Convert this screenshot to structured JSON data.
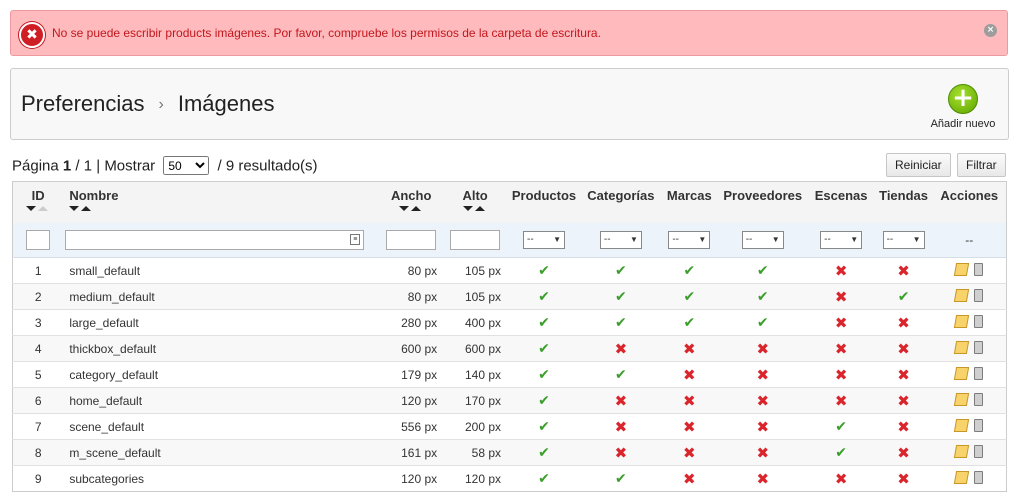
{
  "alert": {
    "message": "No se puede escribir products imágenes. Por favor, compruebe los permisos de la carpeta de escritura.",
    "icon": "error-icon",
    "close": "×"
  },
  "breadcrumb": {
    "parent": "Preferencias",
    "current": "Imágenes",
    "separator": "›"
  },
  "toolbar": {
    "add_label": "Añadir nuevo",
    "add_icon": "+"
  },
  "pagination": {
    "page_label": "Página",
    "page": "1",
    "separator": "/ 1 | Mostrar",
    "per_page": "50",
    "results": "/ 9 resultado(s)"
  },
  "buttons": {
    "reset": "Reiniciar",
    "filter": "Filtrar"
  },
  "columns": {
    "id": "ID",
    "name": "Nombre",
    "width": "Ancho",
    "height": "Alto",
    "products": "Productos",
    "categories": "Categorías",
    "manufacturers": "Marcas",
    "suppliers": "Proveedores",
    "scenes": "Escenas",
    "stores": "Tiendas",
    "actions": "Acciones"
  },
  "filters": {
    "select_value": "--",
    "actions_value": "--"
  },
  "rows": [
    {
      "id": "1",
      "name": "small_default",
      "width": "80 px",
      "height": "105 px",
      "flags": [
        true,
        true,
        true,
        true,
        false,
        false
      ]
    },
    {
      "id": "2",
      "name": "medium_default",
      "width": "80 px",
      "height": "105 px",
      "flags": [
        true,
        true,
        true,
        true,
        false,
        true
      ]
    },
    {
      "id": "3",
      "name": "large_default",
      "width": "280 px",
      "height": "400 px",
      "flags": [
        true,
        true,
        true,
        true,
        false,
        false
      ]
    },
    {
      "id": "4",
      "name": "thickbox_default",
      "width": "600 px",
      "height": "600 px",
      "flags": [
        true,
        false,
        false,
        false,
        false,
        false
      ]
    },
    {
      "id": "5",
      "name": "category_default",
      "width": "179 px",
      "height": "140 px",
      "flags": [
        true,
        true,
        false,
        false,
        false,
        false
      ]
    },
    {
      "id": "6",
      "name": "home_default",
      "width": "120 px",
      "height": "170 px",
      "flags": [
        true,
        false,
        false,
        false,
        false,
        false
      ]
    },
    {
      "id": "7",
      "name": "scene_default",
      "width": "556 px",
      "height": "200 px",
      "flags": [
        true,
        false,
        false,
        false,
        true,
        false
      ]
    },
    {
      "id": "8",
      "name": "m_scene_default",
      "width": "161 px",
      "height": "58 px",
      "flags": [
        true,
        false,
        false,
        false,
        true,
        false
      ]
    },
    {
      "id": "9",
      "name": "subcategories",
      "width": "120 px",
      "height": "120 px",
      "flags": [
        true,
        true,
        false,
        false,
        false,
        false
      ]
    }
  ],
  "colors": {
    "check": "#3a9e2a",
    "cross": "#d9252b",
    "alert_bg": "#ffbabd",
    "alert_text": "#c0181e"
  }
}
